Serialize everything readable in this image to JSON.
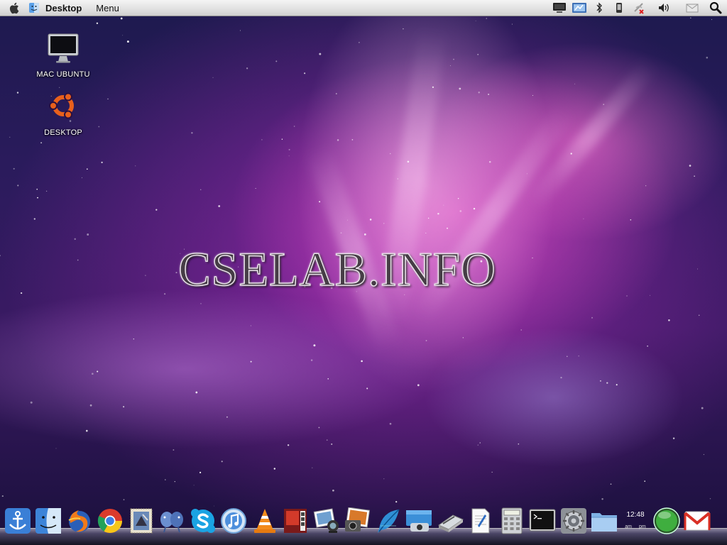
{
  "menubar": {
    "app_name": "Desktop",
    "menu_label": "Menu",
    "icons": {
      "apple": "apple-logo-icon",
      "finder": "finder-mini-icon",
      "tray": [
        "display-icon",
        "network-icon",
        "bluetooth-icon",
        "phone-icon",
        "wireless-off-icon",
        "volume-icon",
        "mail-icon",
        "spotlight-search-icon"
      ]
    }
  },
  "desktop": {
    "icons": [
      {
        "label": "MAC UBUNTU",
        "icon": "imac-computer-icon"
      },
      {
        "label": "DESKTOP",
        "icon": "ubuntu-logo-icon"
      }
    ],
    "watermark": "CSELAB.INFO"
  },
  "dock": {
    "items": [
      "anchor-icon",
      "finder-icon",
      "firefox-icon",
      "chrome-icon",
      "mail-stamp-icon",
      "pidgin-messenger-icon",
      "skype-icon",
      "itunes-icon",
      "vlc-cone-icon",
      "photo-booth-icon",
      "iphoto-icon",
      "image-viewer-icon",
      "screenshot-camera-icon",
      "feather-icon",
      "cheese-webcam-icon",
      "scanner-icon",
      "text-editor-icon",
      "calculator-icon",
      "terminal-icon",
      "system-preferences-icon",
      "folder-icon",
      "clock-widget",
      "green-orb-icon",
      "gmail-icon"
    ],
    "clock": {
      "time": "12:48",
      "am": "am",
      "pm": "pm"
    }
  },
  "colors": {
    "menubar_top": "#f4f4f4",
    "menubar_bottom": "#cfcfcf",
    "wallpaper_magenta": "#c83cb4",
    "wallpaper_deep": "#1d1a4e"
  }
}
